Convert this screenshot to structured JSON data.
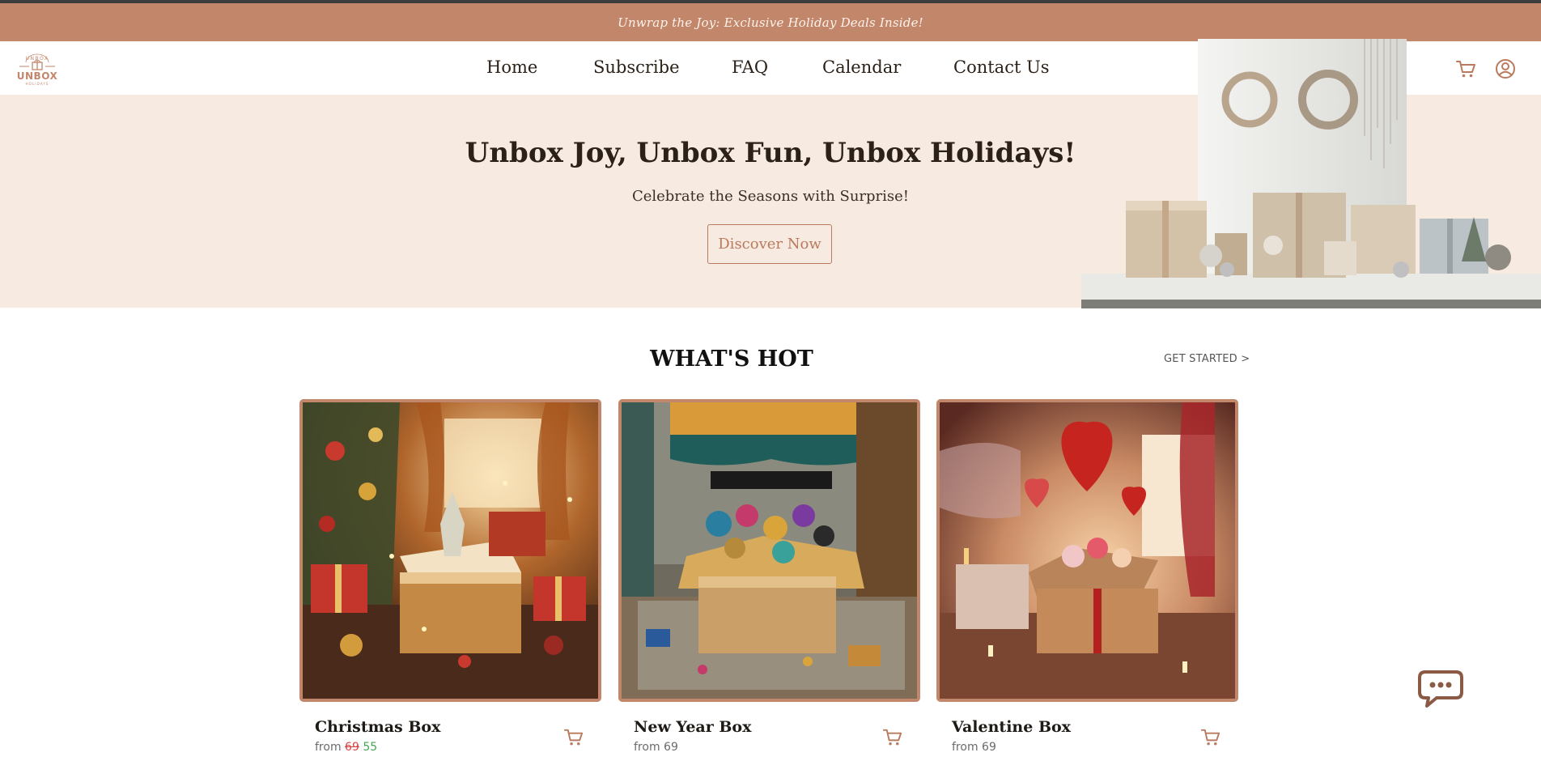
{
  "promo": {
    "text": "Unwrap the Joy: Exclusive Holiday Deals Inside!"
  },
  "logo": {
    "line_top": "UNBOX",
    "line_main": "UNBOX",
    "line_sub": "HOLIDAYS"
  },
  "nav": {
    "items": [
      {
        "label": "Home"
      },
      {
        "label": "Subscribe"
      },
      {
        "label": "FAQ"
      },
      {
        "label": "Calendar"
      },
      {
        "label": "Contact Us"
      }
    ],
    "cart_icon": "cart-icon",
    "account_icon": "user-circle-icon"
  },
  "hero": {
    "title": "Unbox Joy, Unbox Fun, Unbox Holidays!",
    "subtitle": "Celebrate the Seasons with Surprise!",
    "button_label": "Discover Now"
  },
  "hot": {
    "title": "WHAT'S HOT",
    "link_label": "GET STARTED >",
    "products": [
      {
        "name": "Christmas Box",
        "price_prefix": "from",
        "old_price": "69",
        "price": "55"
      },
      {
        "name": "New Year Box",
        "price_prefix": "from",
        "old_price": "",
        "price": "69"
      },
      {
        "name": "Valentine Box",
        "price_prefix": "from",
        "old_price": "",
        "price": "69"
      }
    ]
  },
  "chat": {
    "icon": "chat-bubble-icon"
  },
  "colors": {
    "brand": "#c2866a",
    "hero_bg": "#f7eae0",
    "text_dark": "#2b2118",
    "sale_old": "#d94343",
    "sale_new": "#48a352"
  }
}
